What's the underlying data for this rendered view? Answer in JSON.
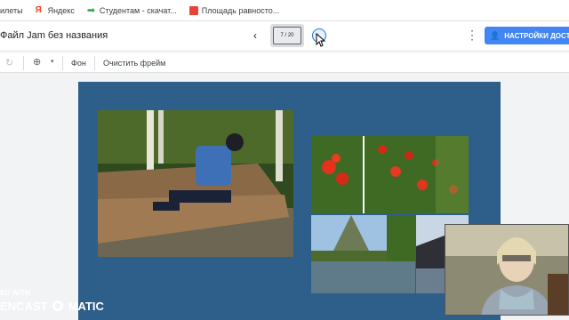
{
  "bookmarks": [
    {
      "label": "илеты",
      "icon": "calendar-icon",
      "color": "#8ab4f8"
    },
    {
      "label": "Яндекс",
      "icon": "yandex-icon",
      "color": "#fc3f1d"
    },
    {
      "label": "Студентам - скачат...",
      "icon": "arrow-right-icon",
      "color": "#34a853"
    },
    {
      "label": "Площадь равносто...",
      "icon": "image-icon",
      "color": "#ea4335"
    }
  ],
  "header": {
    "title": "Файл Jam без названия",
    "frame_counter": "7 / 20",
    "share_label": "НАСТРОЙКИ ДОСТУПА"
  },
  "toolbar": {
    "background_label": "Фон",
    "clear_label": "Очистить фрейм"
  },
  "watermark": {
    "line1": "ED WITH",
    "line2": "ENCAST",
    "line3": "MATIC"
  },
  "colors": {
    "canvas": "#2e5f8a",
    "accent": "#4285f4"
  }
}
